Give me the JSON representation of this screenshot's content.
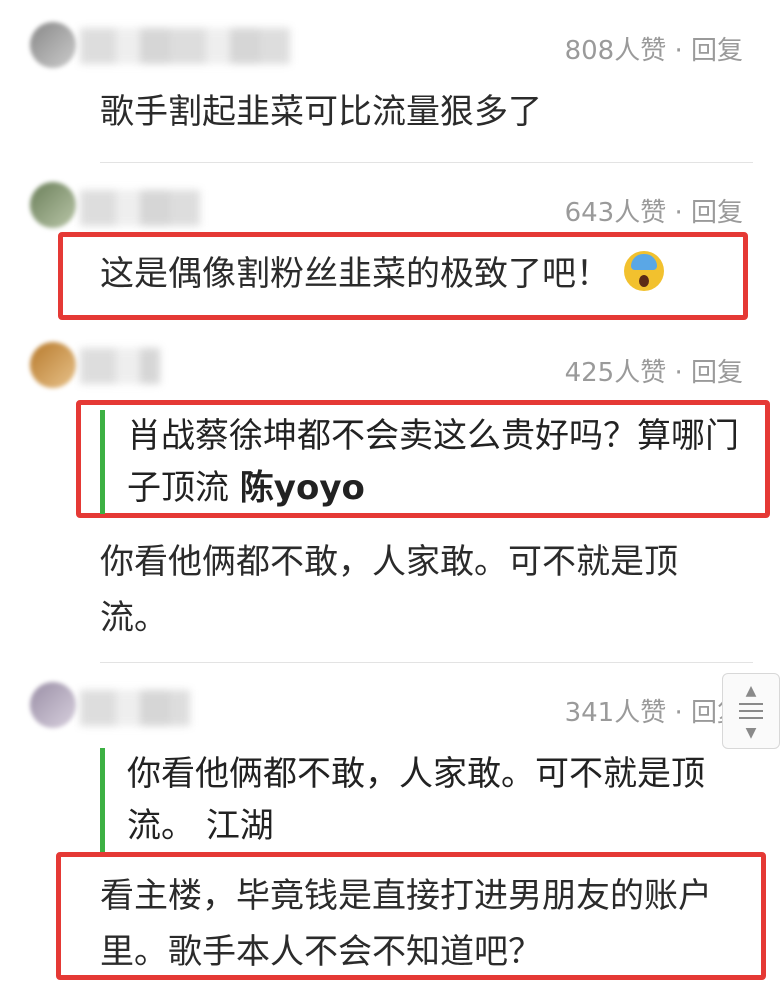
{
  "comments": [
    {
      "likes_reply": "808人赞 · 回复",
      "text": "歌手割起韭菜可比流量狠多了"
    },
    {
      "likes_reply": "643人赞 · 回复",
      "text": "这是偶像割粉丝韭菜的极致了吧！",
      "emoji": "scream-emoji"
    },
    {
      "likes_reply": "425人赞 · 回复",
      "quote": {
        "text": "肖战蔡徐坤都不会卖这么贵好吗？算哪门子顶流",
        "author": "陈yoyo"
      },
      "text": "你看他俩都不敢，人家敢。可不就是顶流。"
    },
    {
      "likes_reply": "341人赞 · 回复",
      "quote": {
        "text": "你看他俩都不敢，人家敢。可不就是顶流。",
        "author": "江湖"
      },
      "text": "看主楼，毕竟钱是直接打进男朋友的账户里。歌手本人不会不知道吧？"
    }
  ],
  "colors": {
    "highlight_border": "#e53935",
    "quote_bar": "#3cb043",
    "meta_text": "#9a9a9a"
  },
  "scroll_control": {
    "icon": "scroll-to-top-icon"
  }
}
